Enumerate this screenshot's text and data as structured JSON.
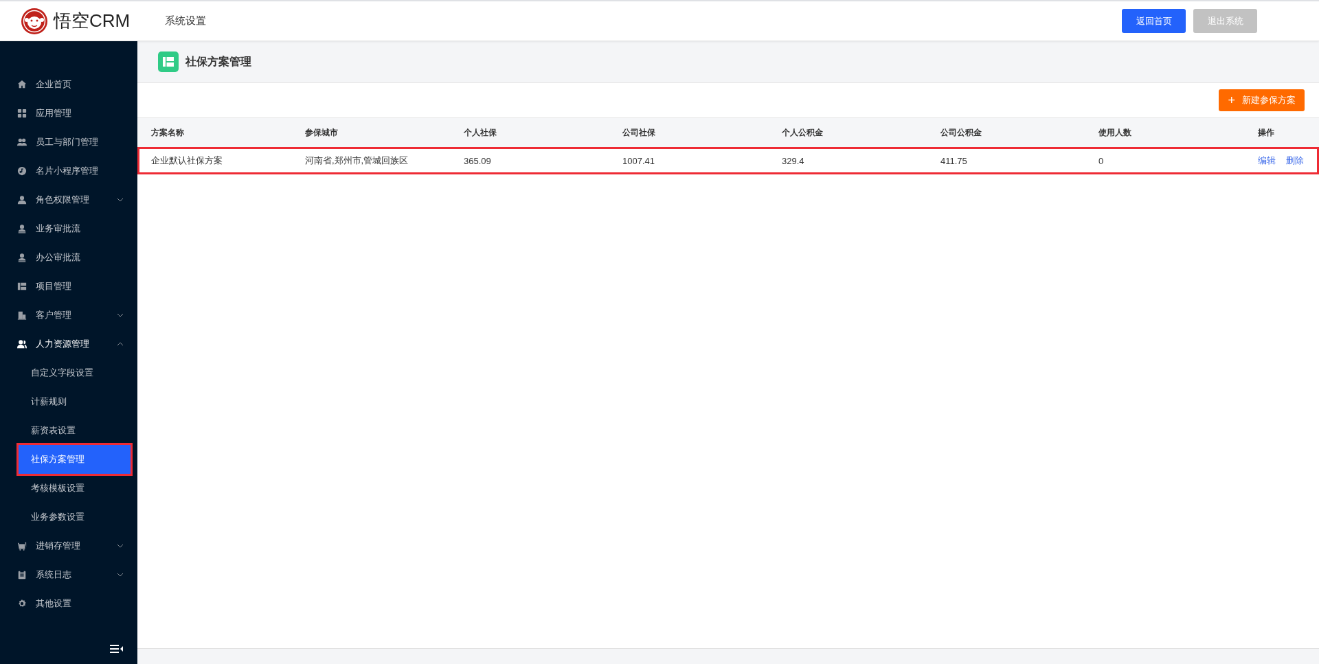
{
  "header": {
    "brand": "悟空CRM",
    "section": "系统设置",
    "buttons": [
      {
        "label": "返回首页",
        "kind": "primary"
      },
      {
        "label": "退出系统",
        "kind": "muted"
      }
    ]
  },
  "sidebar": {
    "items": [
      {
        "label": "企业首页",
        "selected": false
      },
      {
        "label": "应用管理",
        "selected": false
      },
      {
        "label": "员工与部门管理",
        "selected": false
      },
      {
        "label": "名片小程序管理",
        "selected": false
      },
      {
        "label": "角色权限管理",
        "selected": false,
        "expanded": false
      },
      {
        "label": "业务审批流",
        "selected": false
      },
      {
        "label": "办公审批流",
        "selected": false
      },
      {
        "label": "项目管理",
        "selected": false
      },
      {
        "label": "客户管理",
        "selected": false,
        "expanded": false
      },
      {
        "label": "人力资源管理",
        "selected": false,
        "expanded": true,
        "children": [
          {
            "label": "自定义字段设置",
            "selected": false,
            "highlighted": false
          },
          {
            "label": "计薪规则",
            "selected": false,
            "highlighted": false
          },
          {
            "label": "薪资表设置",
            "selected": false,
            "highlighted": false
          },
          {
            "label": "社保方案管理",
            "selected": true,
            "highlighted": true
          },
          {
            "label": "考核模板设置",
            "selected": false,
            "highlighted": false
          },
          {
            "label": "业务参数设置",
            "selected": false,
            "highlighted": false
          }
        ]
      },
      {
        "label": "进销存管理",
        "selected": false,
        "expanded": false
      },
      {
        "label": "系统日志",
        "selected": false,
        "expanded": false
      },
      {
        "label": "其他设置",
        "selected": false
      }
    ]
  },
  "page": {
    "title": "社保方案管理",
    "add_button": "新建参保方案",
    "add_icon": "+"
  },
  "table": {
    "columns": [
      "方案名称",
      "参保城市",
      "个人社保",
      "公司社保",
      "个人公积金",
      "公司公积金",
      "使用人数",
      "操作"
    ],
    "rows": [
      {
        "cells": [
          "企业默认社保方案",
          "河南省,郑州市,管城回族区",
          "365.09",
          "1007.41",
          "329.4",
          "411.75",
          "0"
        ],
        "actions": [
          "编辑",
          "删除"
        ],
        "highlighted": true
      }
    ]
  }
}
